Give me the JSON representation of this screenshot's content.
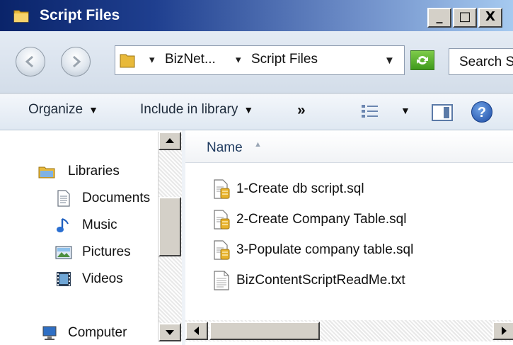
{
  "window": {
    "title": "Script Files",
    "minimize_label": "_",
    "maximize_label": "□",
    "close_label": "X"
  },
  "address": {
    "crumbs": [
      "BizNet...",
      "Script Files"
    ],
    "search_placeholder": "Search S"
  },
  "toolbar": {
    "organize": "Organize",
    "include_in_library": "Include in library",
    "more": "»",
    "help": "?"
  },
  "nav": {
    "items": [
      {
        "label": "Libraries",
        "icon": "libraries-icon"
      },
      {
        "label": "Documents",
        "icon": "documents-icon"
      },
      {
        "label": "Music",
        "icon": "music-icon"
      },
      {
        "label": "Pictures",
        "icon": "pictures-icon"
      },
      {
        "label": "Videos",
        "icon": "videos-icon"
      },
      {
        "label": "Computer",
        "icon": "computer-icon"
      }
    ]
  },
  "files": {
    "column_name": "Name",
    "items": [
      {
        "name": "1-Create db script.sql",
        "icon": "sql-file-icon"
      },
      {
        "name": "2-Create Company Table.sql",
        "icon": "sql-file-icon"
      },
      {
        "name": "3-Populate company table.sql",
        "icon": "sql-file-icon"
      },
      {
        "name": "BizContentScriptReadMe.txt",
        "icon": "text-file-icon"
      }
    ]
  },
  "colors": {
    "titlebar_start": "#0a246a",
    "titlebar_end": "#a6caf0",
    "toolbar_bg": "#dfe8f2"
  }
}
